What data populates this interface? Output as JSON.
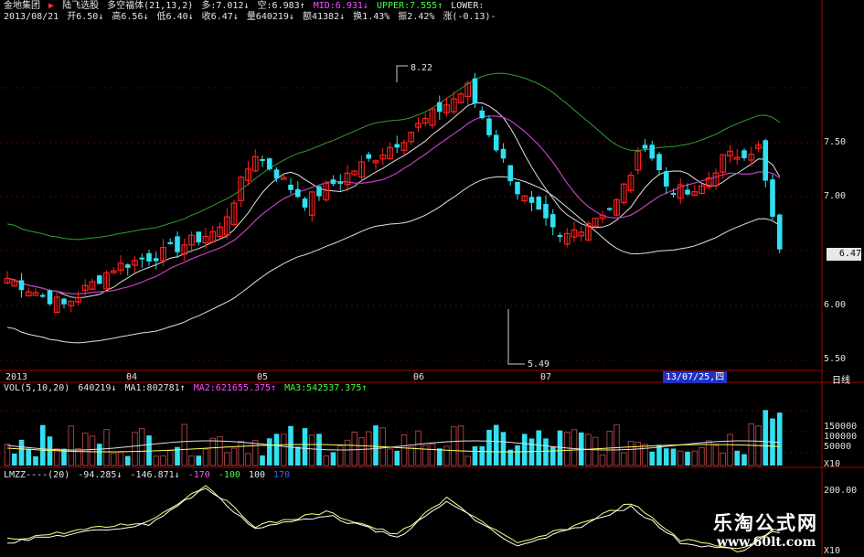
{
  "header": {
    "line1": {
      "stock_name": "金地集团",
      "marker": "▶",
      "indicator": "陆飞选股",
      "formula": "多空福体(21,13,2)",
      "duo": "多:7.012↓",
      "kong": "空:6.983↑",
      "mid": "MID:6.931↓",
      "upper": "UPPER:7.555↑",
      "lower": "LOWER:"
    },
    "line2": {
      "date": "2013/08/21",
      "open": "开6.50↓",
      "high": "高6.56↓",
      "low": "低6.40↓",
      "close": "收6.47↓",
      "volume": "量640219↓",
      "amount": "额41382↓",
      "turnover": "换1.43%",
      "amplitude": "振2.42%",
      "change": "涨(-0.13)-"
    }
  },
  "price_axis": {
    "ticks": [
      "7.50",
      "7.00",
      "6.50",
      "6.00",
      "5.50"
    ],
    "current_price": "6.47"
  },
  "annotations": {
    "high": "8.22",
    "low": "5.49"
  },
  "time_axis": {
    "labels": [
      "2013",
      "04",
      "05",
      "06",
      "07"
    ],
    "cursor_date": "13/07/25,四",
    "period": "日线"
  },
  "volume_panel": {
    "title": "VOL(5,10,20)",
    "value": "640219↓",
    "ma1": "MA1:802781↑",
    "ma2": "MA2:621655.375↑",
    "ma3": "MA3:542537.375↑",
    "ticks": [
      "150000",
      "100000",
      "50000",
      "X10"
    ]
  },
  "lmzz_panel": {
    "title": "LMZZ----(20)",
    "v1": "-94.285↓",
    "v2": "-146.871↓",
    "v3": "-170",
    "v4": "-100",
    "v5": "100",
    "v6": "170",
    "ticks": [
      "200.00",
      "X10"
    ]
  },
  "watermark": {
    "line1": "乐淘公式网",
    "line2": "www.60lt.com"
  },
  "colors": {
    "up": "#ff2020",
    "down": "#30e0f0",
    "ma_white": "#e0e0e0",
    "ma_magenta": "#c040c0",
    "upper_band": "#30a030",
    "grid": "#800000",
    "volume_up": "#a04040",
    "lmzz_line1": "#ffff80",
    "lmzz_line2": "#ffffff"
  }
}
